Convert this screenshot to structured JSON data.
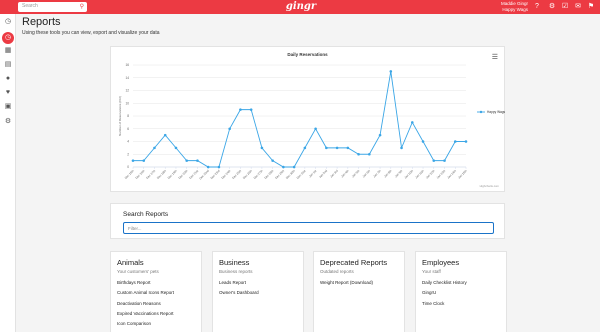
{
  "header": {
    "search_placeholder": "Search",
    "logo": "gingr",
    "user_name": "Maddie Gingr",
    "user_location": "Happy Wags",
    "icons": [
      "help-icon",
      "settings-icon",
      "cart-icon",
      "chat-icon",
      "bell-icon"
    ]
  },
  "sidebar": {
    "icons": [
      "dashboard-icon",
      "clock-icon",
      "calendar-icon",
      "id-card-icon",
      "paw-icon",
      "heart-icon",
      "book-icon",
      "cogs-icon"
    ],
    "active": "clock-icon"
  },
  "page": {
    "title": "Reports",
    "subtitle": "Using these tools you can view, export and visualize your data"
  },
  "chart_menu_icon": "menu-icon",
  "chart_data": {
    "type": "line",
    "title": "Daily Reservations",
    "ylabel": "Number of Reservations (Ctrl)",
    "ylim": [
      0,
      16
    ],
    "yticks": [
      0,
      2,
      4,
      6,
      8,
      10,
      12,
      14,
      16
    ],
    "x": [
      "Dec 15th",
      "Dec 16th",
      "Dec 17th",
      "Dec 18th",
      "Dec 19th",
      "Dec 20th",
      "Dec 21st",
      "Dec 22nd",
      "Dec 23rd",
      "Dec 24th",
      "Dec 25th",
      "Dec 26th",
      "Dec 27th",
      "Dec 28th",
      "Dec 29th",
      "Dec 30th",
      "Dec 31st",
      "Jan 1st",
      "Jan 2nd",
      "Jan 3rd",
      "Jan 4th",
      "Jan 5th",
      "Jan 6th",
      "Jan 7th",
      "Jan 8th",
      "Jan 9th",
      "Jan 10th",
      "Jan 11th",
      "Jan 12th",
      "Jan 13th",
      "Jan 14th",
      "Jan 15th"
    ],
    "series": [
      {
        "name": "Happy Wags",
        "color": "#3ba6e6",
        "values": [
          1,
          1,
          3,
          5,
          3,
          1,
          1,
          0,
          0,
          6,
          9,
          9,
          3,
          1,
          0,
          0,
          3,
          6,
          3,
          3,
          3,
          2,
          2,
          5,
          15,
          3,
          7,
          4,
          1,
          1,
          4,
          4
        ]
      }
    ],
    "legend": "right",
    "credit": "Highcharts.com",
    "grid": true
  },
  "search_reports": {
    "title": "Search Reports",
    "placeholder": "Filter..."
  },
  "report_cards": [
    {
      "title": "Animals",
      "subtitle": "Your customers' pets",
      "items": [
        "Birthdays Report",
        "Custom Animal Icons Report",
        "Deactivation Reasons",
        "Expired Vaccinations Report",
        "Icon Comparison"
      ]
    },
    {
      "title": "Business",
      "subtitle": "Business reports",
      "items": [
        "Leads Report",
        "Owner's Dashboard"
      ]
    },
    {
      "title": "Deprecated Reports",
      "subtitle": "Outdated reports",
      "items": [
        "Weight Report (Download)"
      ]
    },
    {
      "title": "Employees",
      "subtitle": "Your staff",
      "items": [
        "Daily Checklist History",
        "GingrU",
        "Time Clock"
      ]
    }
  ]
}
